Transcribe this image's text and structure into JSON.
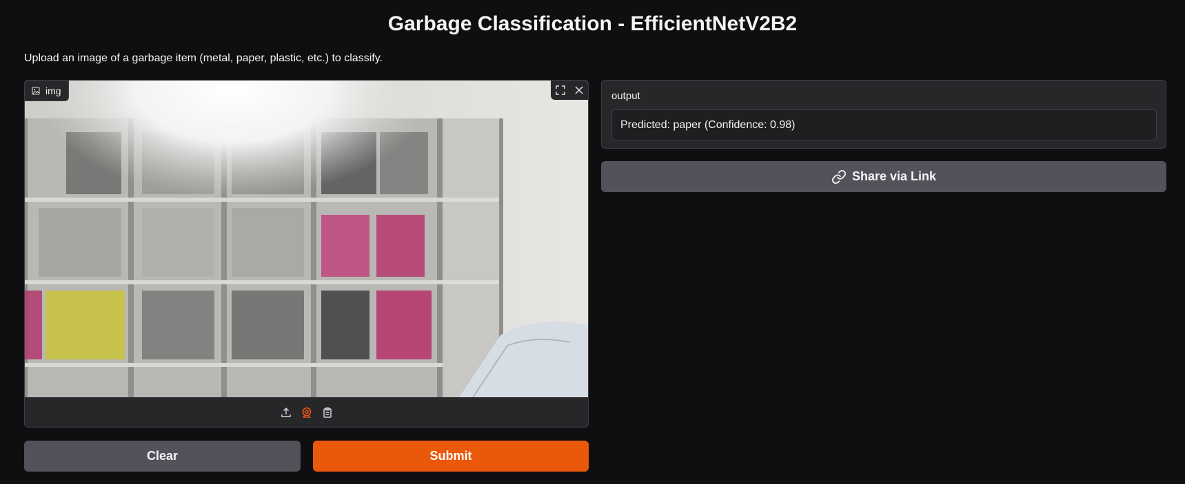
{
  "header": {
    "title": "Garbage Classification - EfficientNetV2B2",
    "description": "Upload an image of a garbage item (metal, paper, plastic, etc.) to classify."
  },
  "input": {
    "label": "img",
    "toolbar_icons": [
      "upload-icon",
      "webcam-icon",
      "clipboard-icon"
    ],
    "action_icons": [
      "fullscreen-icon",
      "close-icon"
    ],
    "active_source": "webcam"
  },
  "buttons": {
    "clear": "Clear",
    "submit": "Submit",
    "share": "Share via Link"
  },
  "output": {
    "label": "output",
    "value": "Predicted: paper (Confidence: 0.98)"
  },
  "colors": {
    "background": "#0f0f11",
    "panel": "#27272a",
    "accent": "#ea580c",
    "secondary_button": "#52525b"
  }
}
